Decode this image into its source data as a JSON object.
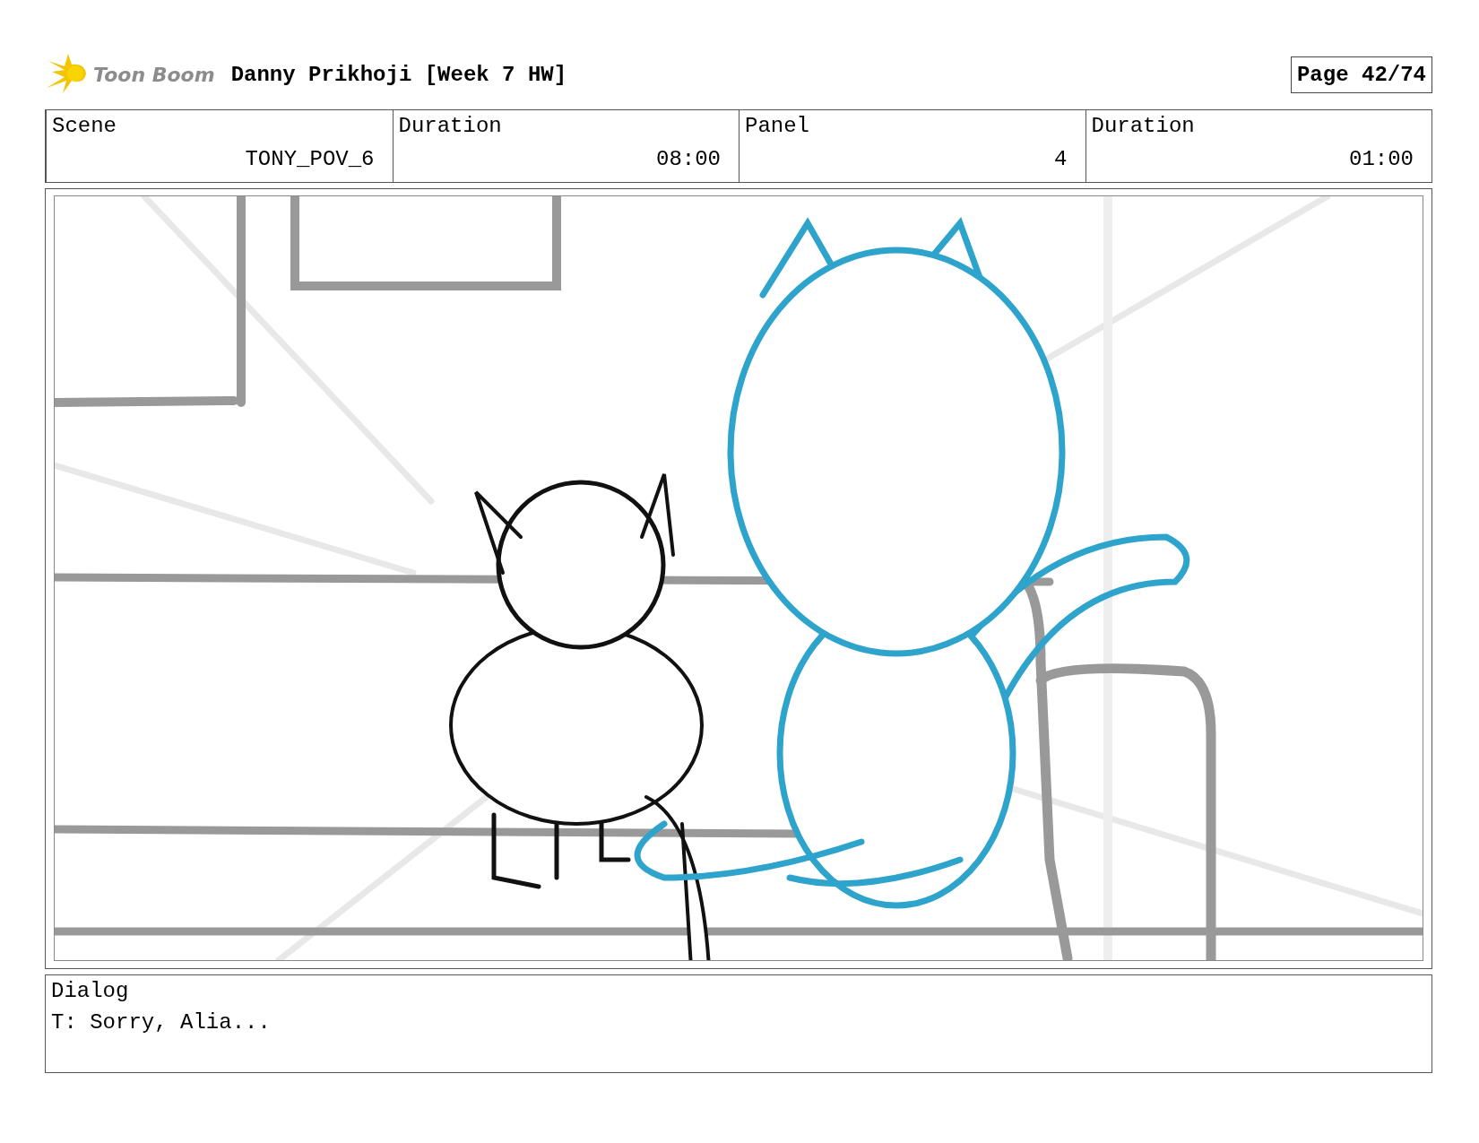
{
  "header": {
    "logo": "Toon Boom",
    "title": "Danny Prikhoji [Week 7 HW]",
    "page": "Page 42/74"
  },
  "fields": [
    {
      "label": "Scene",
      "value": "TONY_POV_6"
    },
    {
      "label": "Duration",
      "value": "08:00"
    },
    {
      "label": "Panel",
      "value": "4"
    },
    {
      "label": "Duration",
      "value": "01:00"
    }
  ],
  "dialog": {
    "label": "Dialog",
    "text": "T: Sorry, Alia..."
  }
}
